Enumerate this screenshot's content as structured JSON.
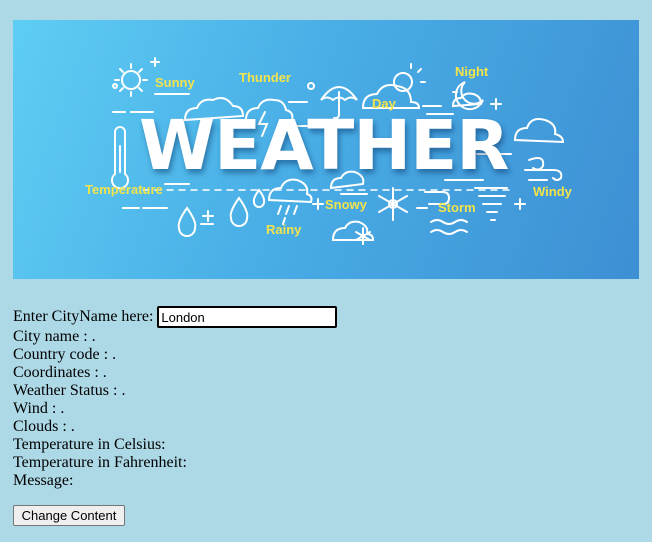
{
  "banner": {
    "title": "WEATHER",
    "words": {
      "sunny": "Sunny",
      "thunder": "Thunder",
      "night": "Night",
      "day": "Day",
      "temperature": "Temperature",
      "windy": "Windy",
      "snowy": "Snowy",
      "storm": "Storm",
      "rainy": "Rainy"
    },
    "colors": {
      "gradient_start": "#5ecdf3",
      "gradient_end": "#3d8fd3",
      "word_color": "#f3e34c"
    }
  },
  "form": {
    "city_label": "Enter CityName here:",
    "city_value": "London",
    "fields": {
      "city_name": "City name : .",
      "country_code": "Country code : .",
      "coordinates": "Coordinates : .",
      "weather_status": "Weather Status : .",
      "wind": "Wind : .",
      "clouds": "Clouds : .",
      "temp_c": "Temperature in Celsius:",
      "temp_f": "Temperature in Fahrenheit:",
      "message": "Message:"
    },
    "button_label": "Change Content"
  }
}
